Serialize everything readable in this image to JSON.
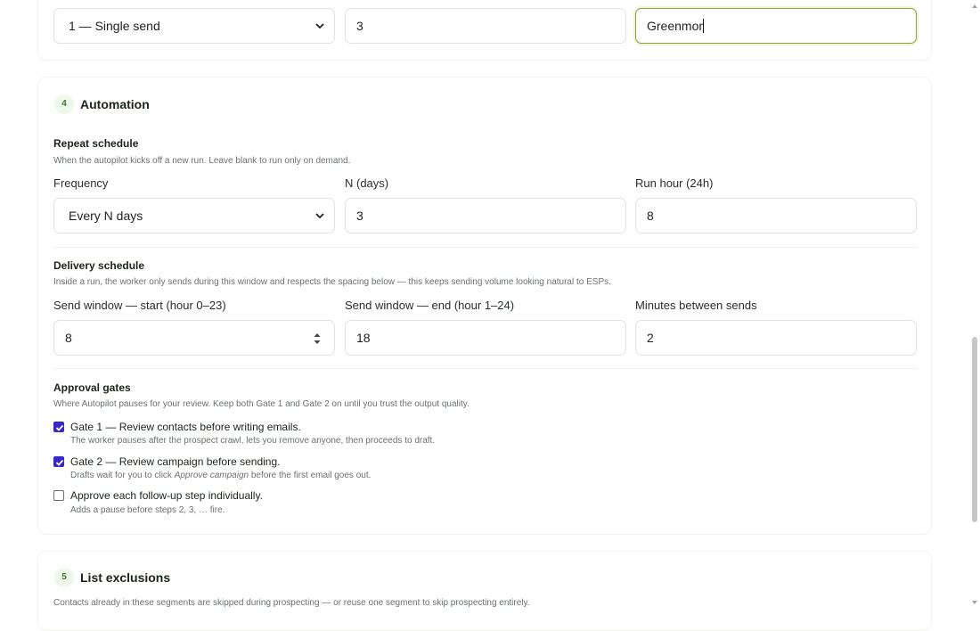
{
  "top_row": {
    "send_mode": "1 — Single send",
    "count_value": "3",
    "name_value": "Greenmor"
  },
  "automation": {
    "number": "4",
    "title": "Automation",
    "repeat": {
      "title": "Repeat schedule",
      "hint": "When the autopilot kicks off a new run. Leave blank to run only on demand.",
      "frequency_label": "Frequency",
      "frequency_value": "Every N days",
      "n_label": "N (days)",
      "n_value": "3",
      "hour_label": "Run hour (24h)",
      "hour_value": "8"
    },
    "delivery": {
      "title": "Delivery schedule",
      "hint": "Inside a run, the worker only sends during this window and respects the spacing below — this keeps sending volume looking natural to ESPs.",
      "start_label": "Send window — start (hour 0–23)",
      "start_value": "8",
      "end_label": "Send window — end (hour 1–24)",
      "end_value": "18",
      "gap_label": "Minutes between sends",
      "gap_value": "2"
    },
    "gates": {
      "title": "Approval gates",
      "hint": "Where Autopilot pauses for your review. Keep both Gate 1 and Gate 2 on until you trust the output quality.",
      "gate1_title": "Gate 1 — Review contacts before writing emails.",
      "gate1_desc": "The worker pauses after the prospect crawl, lets you remove anyone, then proceeds to draft.",
      "gate2_title": "Gate 2 — Review campaign before sending.",
      "gate2_desc_pre": "Drafts wait for you to click ",
      "gate2_desc_em": "Approve campaign",
      "gate2_desc_post": " before the first email goes out.",
      "followup_title": "Approve each follow-up step individually.",
      "followup_desc": "Adds a pause before steps 2, 3, … fire."
    }
  },
  "exclusions": {
    "number": "5",
    "title": "List exclusions",
    "hint": "Contacts already in these segments are skipped during prospecting — or reuse one segment to skip prospecting entirely."
  },
  "colors": {
    "accent_green": "#8aa33e",
    "checkbox_blue": "#3a27c9"
  }
}
